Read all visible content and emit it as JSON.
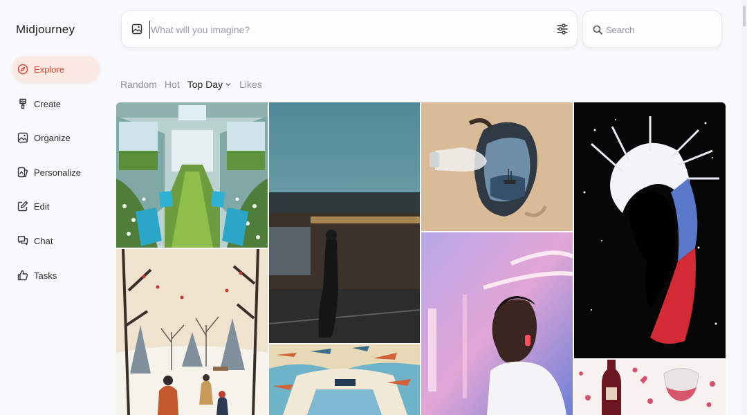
{
  "app": {
    "brand": "Midjourney"
  },
  "sidebar": {
    "items": [
      {
        "label": "Explore",
        "icon": "compass-icon",
        "active": true
      },
      {
        "label": "Create",
        "icon": "brush-icon"
      },
      {
        "label": "Organize",
        "icon": "image-icon"
      },
      {
        "label": "Personalize",
        "icon": "personalize-icon"
      },
      {
        "label": "Edit",
        "icon": "edit-icon"
      },
      {
        "label": "Chat",
        "icon": "chat-icon"
      },
      {
        "label": "Tasks",
        "icon": "thumbs-up-icon"
      }
    ]
  },
  "prompt": {
    "placeholder": "What will you imagine?",
    "value": ""
  },
  "search": {
    "placeholder": "Search",
    "value": ""
  },
  "feed_tabs": [
    {
      "label": "Random"
    },
    {
      "label": "Hot"
    },
    {
      "label": "Top Day",
      "active": true,
      "has_dropdown": true
    },
    {
      "label": "Likes"
    }
  ],
  "gallery": [
    {
      "name": "image-train-interior-meadow"
    },
    {
      "name": "image-winter-park-illustration"
    },
    {
      "name": "image-motion-blur-train-platform"
    },
    {
      "name": "image-airplanes-collage"
    },
    {
      "name": "image-bottle-ship-in-sand"
    },
    {
      "name": "image-neon-portrait"
    },
    {
      "name": "image-splash-silhouette"
    },
    {
      "name": "image-wine-hearts"
    }
  ],
  "colors": {
    "accent": "#d8452f",
    "accent_bg": "#fde9e4",
    "background": "#f7f9fa"
  }
}
